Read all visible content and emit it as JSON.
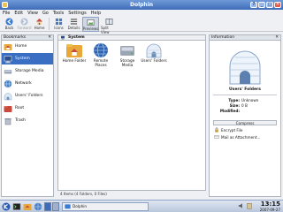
{
  "window": {
    "title": "Dolphin",
    "buttons": [
      "?",
      "_",
      "□",
      "✕"
    ]
  },
  "menu": [
    "File",
    "Edit",
    "View",
    "Go",
    "Tools",
    "Settings",
    "Help"
  ],
  "toolbar": [
    {
      "label": "Back",
      "icon": "back-arrow-icon",
      "enabled": true
    },
    {
      "label": "Forward",
      "icon": "forward-arrow-icon",
      "enabled": false
    },
    {
      "label": "Home",
      "icon": "home-icon",
      "enabled": true
    },
    {
      "label": "Icons",
      "icon": "icons-view-icon",
      "enabled": true
    },
    {
      "label": "Details",
      "icon": "details-view-icon",
      "enabled": true
    },
    {
      "label": "Previews",
      "icon": "previews-icon",
      "enabled": true,
      "active": true
    },
    {
      "label": "Split View",
      "icon": "split-view-icon",
      "enabled": true
    }
  ],
  "bookmarks": {
    "title": "Bookmarks",
    "items": [
      {
        "label": "Home",
        "icon": "home-folder-icon"
      },
      {
        "label": "System",
        "icon": "system-icon",
        "selected": true
      },
      {
        "label": "Storage Media",
        "icon": "storage-media-icon"
      },
      {
        "label": "Network",
        "icon": "network-icon"
      },
      {
        "label": "Users' Folders",
        "icon": "users-folders-icon"
      },
      {
        "label": "Root",
        "icon": "root-folder-icon"
      },
      {
        "label": "Trash",
        "icon": "trash-icon"
      }
    ]
  },
  "location": {
    "label": "System"
  },
  "files": [
    {
      "label": "Home Folder",
      "icon": "home-folder-icon"
    },
    {
      "label": "Remote Places",
      "icon": "remote-places-icon"
    },
    {
      "label": "Storage Media",
      "icon": "storage-media-icon"
    },
    {
      "label": "Users' Folders",
      "icon": "users-folders-icon"
    }
  ],
  "status": "4 Items (4 Folders, 0 Files)",
  "info": {
    "title": "Information",
    "item_name": "Users' Folders",
    "rows": [
      {
        "key": "Type:",
        "value": "Unknown"
      },
      {
        "key": "Size:",
        "value": "0 B"
      },
      {
        "key": "Modified:",
        "value": ""
      }
    ],
    "actions_title": "Compress",
    "actions": [
      {
        "label": "Encrypt File",
        "icon": "lock-icon"
      },
      {
        "label": "Mail as Attachment...",
        "icon": "mail-icon"
      }
    ]
  },
  "taskbar": {
    "task_label": "Dolphin",
    "time": "13:15",
    "date": "2007-09-27"
  },
  "colors": {
    "selection": "#3a6ec2",
    "titlebar": "#3f6cb8",
    "accent_folder": "#f0c04a"
  }
}
